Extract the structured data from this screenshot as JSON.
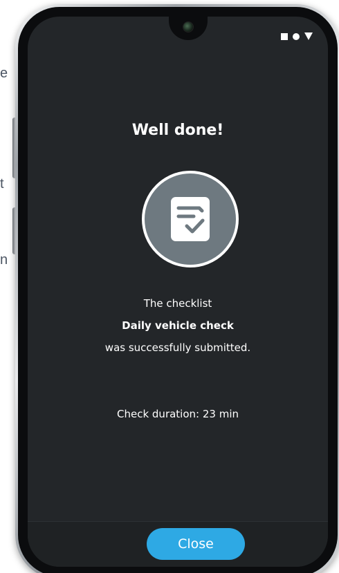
{
  "background": {
    "fragments": [
      "e",
      "t",
      "n"
    ]
  },
  "status_bar": {
    "icons": [
      "square-icon",
      "circle-icon",
      "triangle-icon"
    ]
  },
  "screen": {
    "title": "Well done!",
    "icon": "checklist-icon",
    "message_line_1": "The checklist",
    "checklist_name": "Daily vehicle check",
    "message_line_3": "was successfully submitted.",
    "duration_text": "Check duration: 23 min"
  },
  "actions": {
    "close_label": "Close"
  },
  "colors": {
    "screen_background": "#232629",
    "badge_background": "#6e7980",
    "button_accent": "#2ea9e4",
    "text": "#ffffff"
  }
}
